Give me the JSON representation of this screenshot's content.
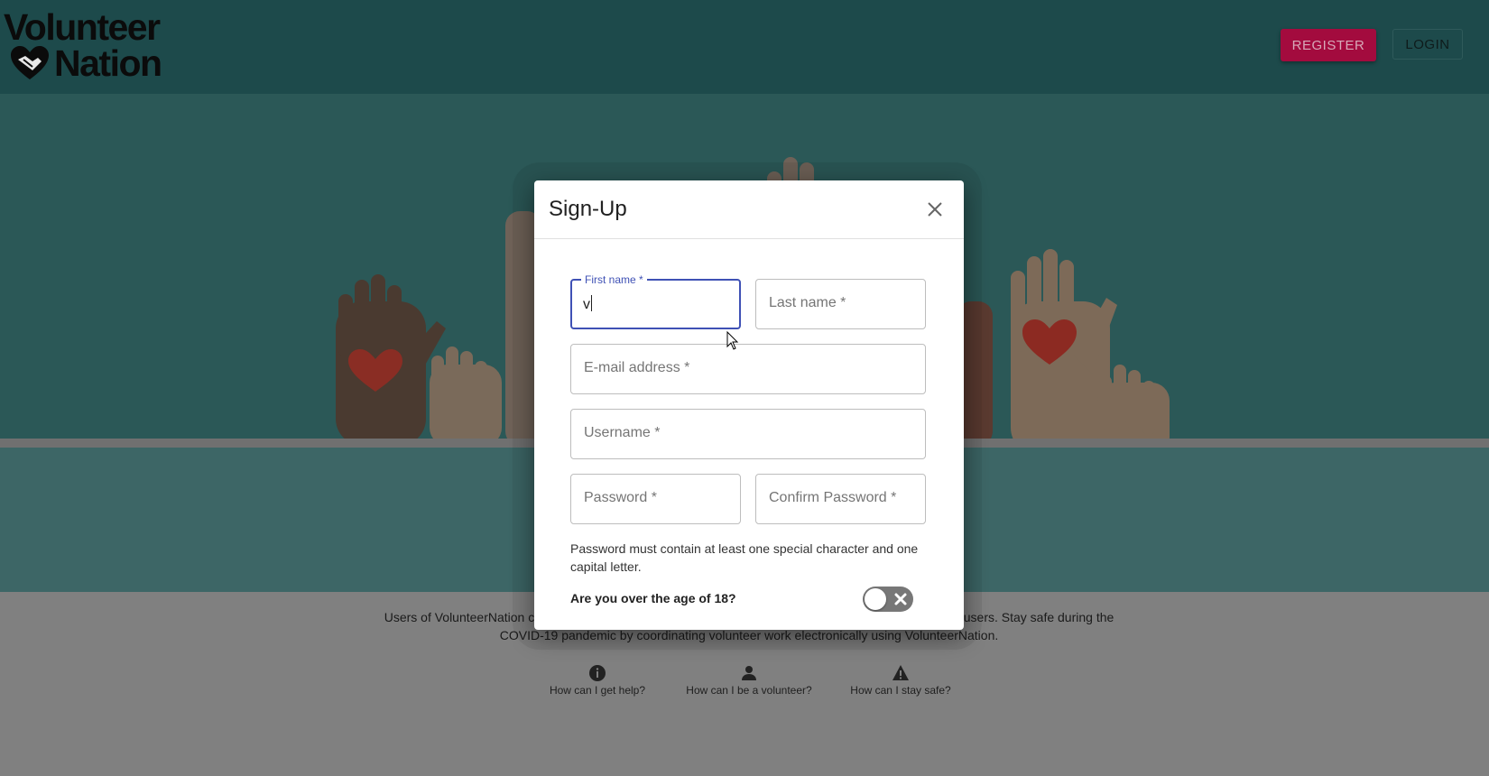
{
  "header": {
    "logo_line1": "Volunteer",
    "logo_line2": "Nation",
    "register_label": "REGISTER",
    "login_label": "LOGIN"
  },
  "footer": {
    "description": "Users of VolunteerNation can post requests for help and volunteer their time to meet the needs of other users. Stay safe during the COVID-19 pandemic by coordinating volunteer work electronically using VolunteerNation.",
    "links": [
      {
        "label": "How can I get help?",
        "icon": "info-icon"
      },
      {
        "label": "How can I be a volunteer?",
        "icon": "person-icon"
      },
      {
        "label": "How can I stay safe?",
        "icon": "warning-icon"
      }
    ]
  },
  "modal": {
    "title": "Sign-Up",
    "fields": {
      "first_name": {
        "label": "First name *",
        "value": "v"
      },
      "last_name": {
        "placeholder": "Last name *"
      },
      "email": {
        "placeholder": "E-mail address *"
      },
      "username": {
        "placeholder": "Username *"
      },
      "password": {
        "placeholder": "Password *"
      },
      "confirm_password": {
        "placeholder": "Confirm Password *"
      }
    },
    "password_hint": "Password must contain at least one special character and one capital letter.",
    "age_question": "Are you over the age of 18?",
    "age_toggle_on": false
  },
  "colors": {
    "header_bg": "#1d4a4b",
    "hero_bg": "#2b5857",
    "register_bg": "#a30b3e",
    "focus_accent": "#3f51b5"
  }
}
